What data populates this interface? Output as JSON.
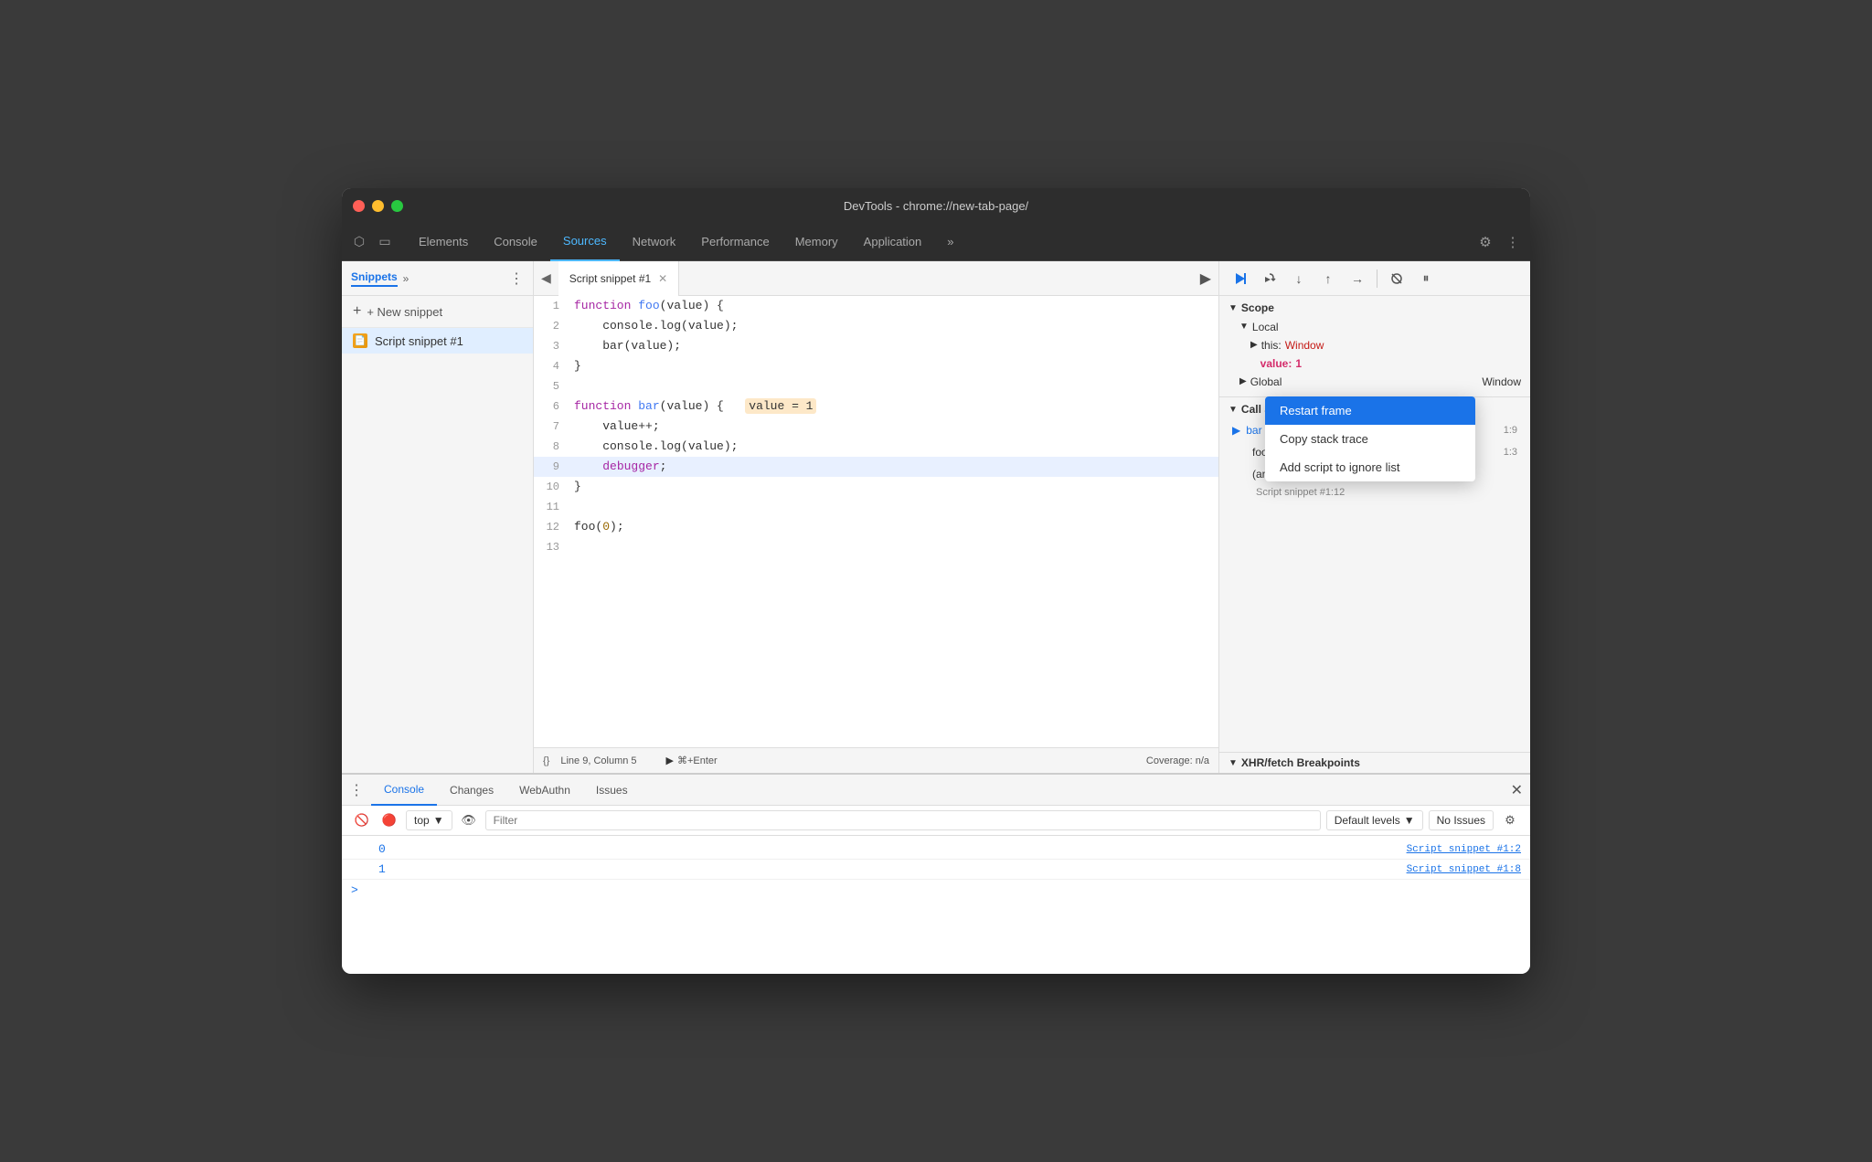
{
  "window": {
    "title": "DevTools - chrome://new-tab-page/"
  },
  "tabs": {
    "items": [
      {
        "label": "Elements"
      },
      {
        "label": "Console"
      },
      {
        "label": "Sources"
      },
      {
        "label": "Network"
      },
      {
        "label": "Performance"
      },
      {
        "label": "Memory"
      },
      {
        "label": "Application"
      },
      {
        "label": "»"
      }
    ],
    "active": "Sources"
  },
  "sidebar": {
    "title": "Snippets",
    "new_snippet_label": "+ New snippet",
    "snippet_name": "Script snippet #1"
  },
  "editor": {
    "tab_label": "Script snippet #1",
    "lines": [
      {
        "num": "1",
        "content": "function foo(value) {"
      },
      {
        "num": "2",
        "content": "    console.log(value);"
      },
      {
        "num": "3",
        "content": "    bar(value);"
      },
      {
        "num": "4",
        "content": "}"
      },
      {
        "num": "5",
        "content": ""
      },
      {
        "num": "6",
        "content": "function bar(value) {"
      },
      {
        "num": "7",
        "content": "    value++;"
      },
      {
        "num": "8",
        "content": "    console.log(value);"
      },
      {
        "num": "9",
        "content": "    debugger;",
        "active": true
      },
      {
        "num": "10",
        "content": "}"
      },
      {
        "num": "11",
        "content": ""
      },
      {
        "num": "12",
        "content": "foo(0);"
      },
      {
        "num": "13",
        "content": ""
      }
    ],
    "status": {
      "format": "{}",
      "position": "Line 9, Column 5",
      "run_hint": "⌘+Enter",
      "coverage": "Coverage: n/a"
    }
  },
  "right_panel": {
    "debug_buttons": [
      "resume",
      "step_over",
      "step_into",
      "step_out",
      "step",
      "deactivate",
      "pause"
    ],
    "scope": {
      "title": "Scope",
      "local_title": "Local",
      "this_label": "this:",
      "this_value": "Window",
      "value_label": "value:",
      "value_val": "1",
      "global_title": "Global",
      "global_value": "Window"
    },
    "call_stack": {
      "title": "Call Stack",
      "items": [
        {
          "name": "bar",
          "loc": "1:9",
          "active": true
        },
        {
          "name": "foo",
          "loc": "1:3"
        },
        {
          "name": "(anonymous)",
          "loc": ""
        }
      ],
      "snippet_label": "Script snippet #1:12"
    }
  },
  "context_menu": {
    "items": [
      {
        "label": "Restart frame",
        "highlighted": true
      },
      {
        "label": "Copy stack trace"
      },
      {
        "label": "Add script to ignore list"
      }
    ]
  },
  "xhr_section": {
    "title": "XHR/fetch Breakpoints"
  },
  "console": {
    "tabs": [
      {
        "label": "Console"
      },
      {
        "label": "Changes"
      },
      {
        "label": "WebAuthn"
      },
      {
        "label": "Issues"
      }
    ],
    "active_tab": "Console",
    "filter_placeholder": "Filter",
    "top_label": "top",
    "levels_label": "Default levels",
    "issues_label": "No Issues",
    "logs": [
      {
        "value": "0",
        "src": "Script snippet #1:2"
      },
      {
        "value": "1",
        "src": "Script snippet #1:8"
      }
    ]
  }
}
